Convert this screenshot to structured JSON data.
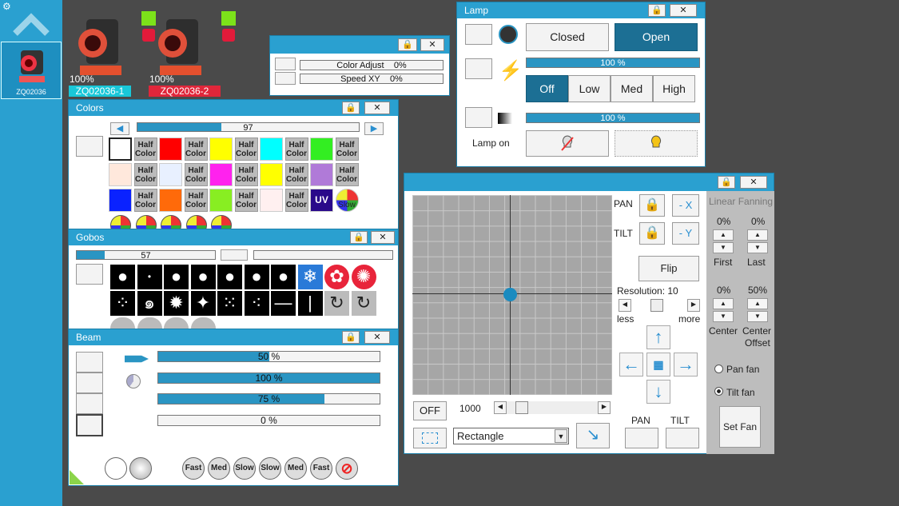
{
  "sidebar": {
    "fixture_label": "ZQ02036"
  },
  "fixtures": [
    {
      "percent": "100%",
      "label": "ZQ02036-1",
      "label_color": "#19c7d8"
    },
    {
      "percent": "100%",
      "label": "ZQ02036-2",
      "label_color": "#e0263a"
    }
  ],
  "small_panel": {
    "rows": [
      {
        "label": "Color Adjust",
        "value": "0%"
      },
      {
        "label": "Speed XY",
        "value": "0%"
      }
    ]
  },
  "lamp": {
    "title": "Lamp",
    "closed_label": "Closed",
    "open_label": "Open",
    "bar1": "100 %",
    "bar1_value": 100,
    "levels": [
      "Off",
      "Low",
      "Med",
      "High"
    ],
    "bar2": "100 %",
    "bar2_value": 100,
    "lamp_on_label": "Lamp on"
  },
  "colors": {
    "title": "Colors",
    "slider_value": "97",
    "slider_fill": 0.38,
    "half_label": "Half Color",
    "uv_label": "UV",
    "slow_label": "Slow"
  },
  "gobos": {
    "title": "Gobos",
    "slider_value": "57",
    "slider_fill": 0.2
  },
  "beam": {
    "title": "Beam",
    "bars": [
      {
        "text": "50 %",
        "value": 50
      },
      {
        "text": "100 %",
        "value": 100
      },
      {
        "text": "75 %",
        "value": 75
      },
      {
        "text": "0 %",
        "value": 0
      }
    ],
    "speed_labels": [
      "Fast",
      "Med",
      "Slow",
      "Slow",
      "Med",
      "Fast"
    ]
  },
  "pantilt": {
    "pan_label": "PAN",
    "tilt_label": "TILT",
    "neg_x": "- X",
    "neg_y": "- Y",
    "flip_label": "Flip",
    "resolution": "Resolution: 10",
    "less": "less",
    "more": "more",
    "off_label": "OFF",
    "speed_value": "1000",
    "shape_select": "Rectangle",
    "pan_bottom": "PAN",
    "tilt_bottom": "TILT"
  },
  "fanning": {
    "title": "Linear Fanning",
    "first_pct": "0%",
    "last_pct": "0%",
    "first_label": "First",
    "last_label": "Last",
    "center_pct": "0%",
    "offset_pct": "50%",
    "center_label": "Center",
    "offset_label_1": "Center",
    "offset_label_2": "Offset",
    "pan_fan": "Pan fan",
    "tilt_fan": "Tilt fan",
    "set_fan": "Set Fan"
  }
}
